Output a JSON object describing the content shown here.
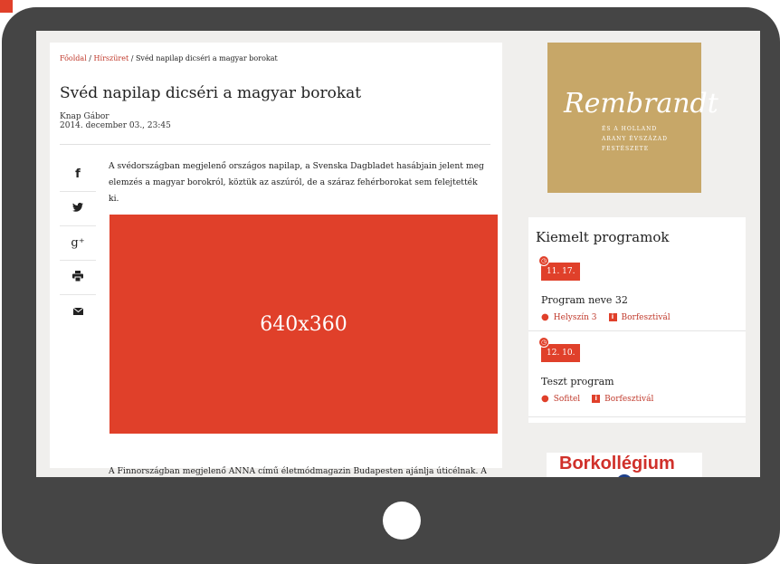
{
  "breadcrumb": {
    "home": "Főoldal",
    "sep1": " / ",
    "section": "Hírszüret",
    "sep2": " / ",
    "current": "Svéd napilap dicséri a magyar borokat"
  },
  "article": {
    "title": "Svéd napilap dicséri a magyar borokat",
    "author": "Knap Gábor",
    "date": "2014. december 03., 23:45",
    "para1": "A svédországban megjelenő országos napilap, a Svenska Dagbladet hasábjain jelent meg elemzés a magyar borokról, köztük az aszúról, de a száraz fehérborokat sem felejtették ki.",
    "image_label": "640x360",
    "para2": "A Finnországban megjelenő ANNA című életmódmagazin Budapesten ajánlja úticélnak. A"
  },
  "share": [
    {
      "icon": "facebook-icon",
      "glyph": "f"
    },
    {
      "icon": "twitter-icon",
      "glyph": "🐦"
    },
    {
      "icon": "googleplus-icon",
      "glyph": "g⁺"
    },
    {
      "icon": "print-icon",
      "glyph": "🖶"
    },
    {
      "icon": "email-icon",
      "glyph": "✉"
    }
  ],
  "ad_rembrandt": {
    "title": "Rembrandt",
    "line1": "ÉS A HOLLAND",
    "line2": "ARANY ÉVSZÁZAD",
    "line3": "FESTÉSZETE"
  },
  "programs": {
    "heading": "Kiemelt programok",
    "items": [
      {
        "date": "11. 17.",
        "name": "Program neve 32",
        "venue": "Helyszín 3",
        "category": "Borfesztivál"
      },
      {
        "date": "12. 10.",
        "name": "Teszt program",
        "venue": "Sofitel",
        "category": "Borfesztivál"
      }
    ]
  },
  "ad_borko": {
    "text": "Borkollégium"
  },
  "colors": {
    "accent": "#e0402a",
    "frame": "#454545",
    "gold": "#c7a768",
    "bg": "#f0efed"
  }
}
